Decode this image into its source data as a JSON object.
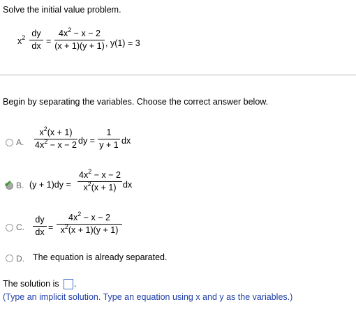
{
  "problem": {
    "prompt": "Solve the initial value problem.",
    "lhs_x": "x",
    "lhs_exp": "2",
    "lhs_num": "dy",
    "lhs_den": "dx",
    "eq": "=",
    "rhs_num_a": "4x",
    "rhs_num_exp": "2",
    "rhs_num_b": " − x − 2",
    "rhs_den": "(x + 1)(y + 1)",
    "ic": ", y(1) = 3"
  },
  "step": {
    "instruction": "Begin by separating the variables. Choose the correct answer below."
  },
  "options": {
    "a": {
      "label": "A.",
      "num_x": "x",
      "num_exp": "2",
      "num_rest": "(x + 1)",
      "den_a": "4x",
      "den_exp": "2",
      "den_rest": " − x − 2",
      "mid": "dy =",
      "rnum": "1",
      "rden": "y + 1",
      "tail": "dx"
    },
    "b": {
      "label": "B.",
      "lhs": "(y + 1)dy =",
      "num_a": "4x",
      "num_exp": "2",
      "num_rest": " − x − 2",
      "den_x": "x",
      "den_exp": "2",
      "den_rest": "(x + 1)",
      "tail": "dx"
    },
    "c": {
      "label": "C.",
      "num": "dy",
      "den": "dx",
      "eq": "=",
      "rnum_a": "4x",
      "rnum_exp": "2",
      "rnum_rest": " − x − 2",
      "rden_x": "x",
      "rden_exp": "2",
      "rden_rest": "(x + 1)(y + 1)"
    },
    "d": {
      "label": "D.",
      "text": "The equation is already separated."
    }
  },
  "solution": {
    "prefix": "The solution is",
    "suffix": ".",
    "hint": "(Type an implicit solution. Type an equation using x and y as the variables.)"
  },
  "colors": {
    "hint": "#1f3fa8",
    "check": "#3a9a2a",
    "divider": "#b8b8b8"
  }
}
